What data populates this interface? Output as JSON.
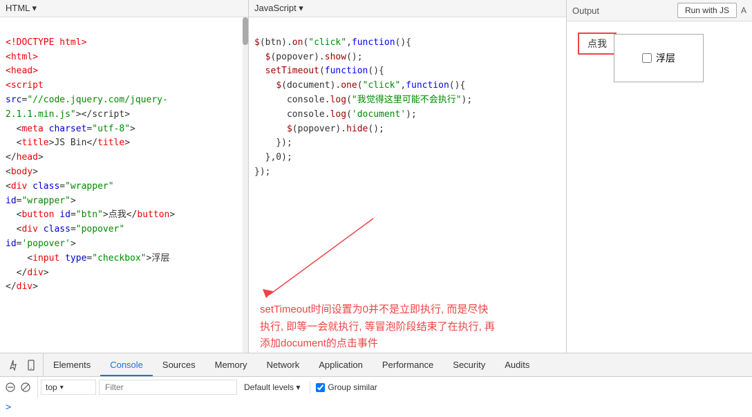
{
  "htmlPanel": {
    "header": "HTML ▾",
    "code": "<!DOCTYPE html>\n<html>\n<head>\n<script\nsrc=\"//code.jquery.com/jquery-\n2.1.1.min.js\"></script>\n  <meta charset=\"utf-8\">\n  <title>JS Bin</title>\n</head>\n<body>\n<div class=\"wrapper\"\nid=\"wrapper\">\n  <button id=\"btn\">点我</button>\n  <div class=\"popover\"\nid='popover'>\n    <input type=\"checkbox\">浮层\n  </div>\n</div>\n"
  },
  "jsPanel": {
    "header": "JavaScript ▾",
    "code_lines": [
      "$(btn).on(\"click\",function(){",
      "  $(popover).show();",
      "  setTimeout(function(){",
      "    $(document).one(\"click\",function(){",
      "      console.log(\"我觉得这里可能不会执行\");",
      "      console.log('document');",
      "      $(popover).hide();",
      "    });",
      "  },0);",
      "});"
    ]
  },
  "outputPanel": {
    "label": "Output",
    "runButton": "Run with JS",
    "demoButton": "点我",
    "popoverCheckbox": "浮层"
  },
  "annotation": {
    "text": "setTimeout时间设置为0并不是立即执行, 而是尽快\n执行, 即等一会就执行, 等冒泡阶段结束了在执行, 再\n添加document的点击事件"
  },
  "devtools": {
    "tabs": [
      "Elements",
      "Console",
      "Sources",
      "Memory",
      "Network",
      "Application",
      "Performance",
      "Security",
      "Audits"
    ],
    "activeTab": "Console",
    "consoleBar": {
      "filterPlaceholder": "Filter",
      "defaultLevels": "Default levels ▾",
      "groupSimilar": "Group similar",
      "groupSimilarChecked": true,
      "topDropdown": "top ▾"
    },
    "promptSymbol": ">"
  }
}
